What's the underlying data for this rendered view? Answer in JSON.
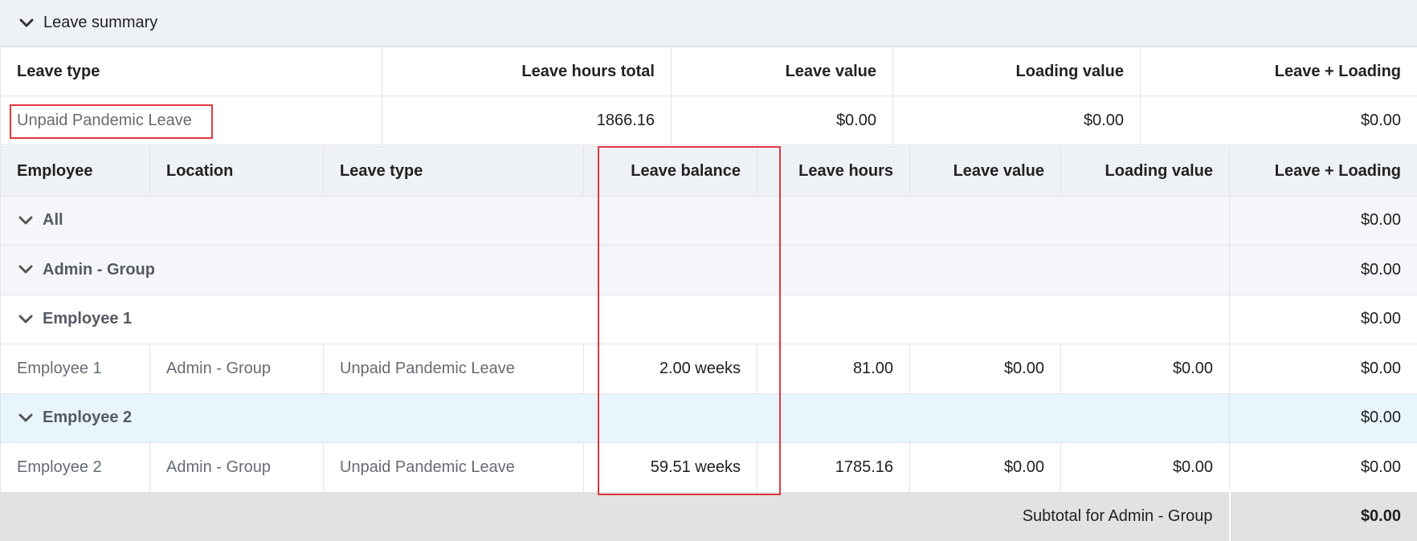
{
  "section": {
    "title": "Leave summary"
  },
  "summary": {
    "headers": [
      "Leave type",
      "Leave hours total",
      "Leave value",
      "Loading value",
      "Leave + Loading"
    ],
    "row": {
      "leave_type": "Unpaid Pandemic Leave",
      "hours_total": "1866.16",
      "leave_value": "$0.00",
      "loading_value": "$0.00",
      "leave_loading": "$0.00"
    }
  },
  "detail": {
    "headers": [
      "Employee",
      "Location",
      "Leave type",
      "Leave balance",
      "Leave hours",
      "Leave value",
      "Loading value",
      "Leave + Loading"
    ],
    "groups": {
      "all": {
        "label": "All",
        "total": "$0.00"
      },
      "admin": {
        "label": "Admin - Group",
        "total": "$0.00"
      },
      "emp1": {
        "label": "Employee 1",
        "total": "$0.00"
      },
      "emp2": {
        "label": "Employee 2",
        "total": "$0.00"
      }
    },
    "rows": [
      {
        "employee": "Employee 1",
        "location": "Admin - Group",
        "leave_type": "Unpaid Pandemic Leave",
        "balance": "2.00 weeks",
        "hours": "81.00",
        "leave_value": "$0.00",
        "loading_value": "$0.00",
        "leave_loading": "$0.00"
      },
      {
        "employee": "Employee 2",
        "location": "Admin - Group",
        "leave_type": "Unpaid Pandemic Leave",
        "balance": "59.51 weeks",
        "hours": "1785.16",
        "leave_value": "$0.00",
        "loading_value": "$0.00",
        "leave_loading": "$0.00"
      }
    ],
    "subtotal": {
      "label": "Subtotal for Admin - Group",
      "value": "$0.00"
    }
  },
  "colors": {
    "highlight": "#e0383e",
    "header_bg": "#eef1f6",
    "selected_group_bg": "#e8f5fc",
    "subtotal_bg": "#e2e2e2"
  },
  "icons": {
    "collapse": "chevron-down-icon"
  }
}
